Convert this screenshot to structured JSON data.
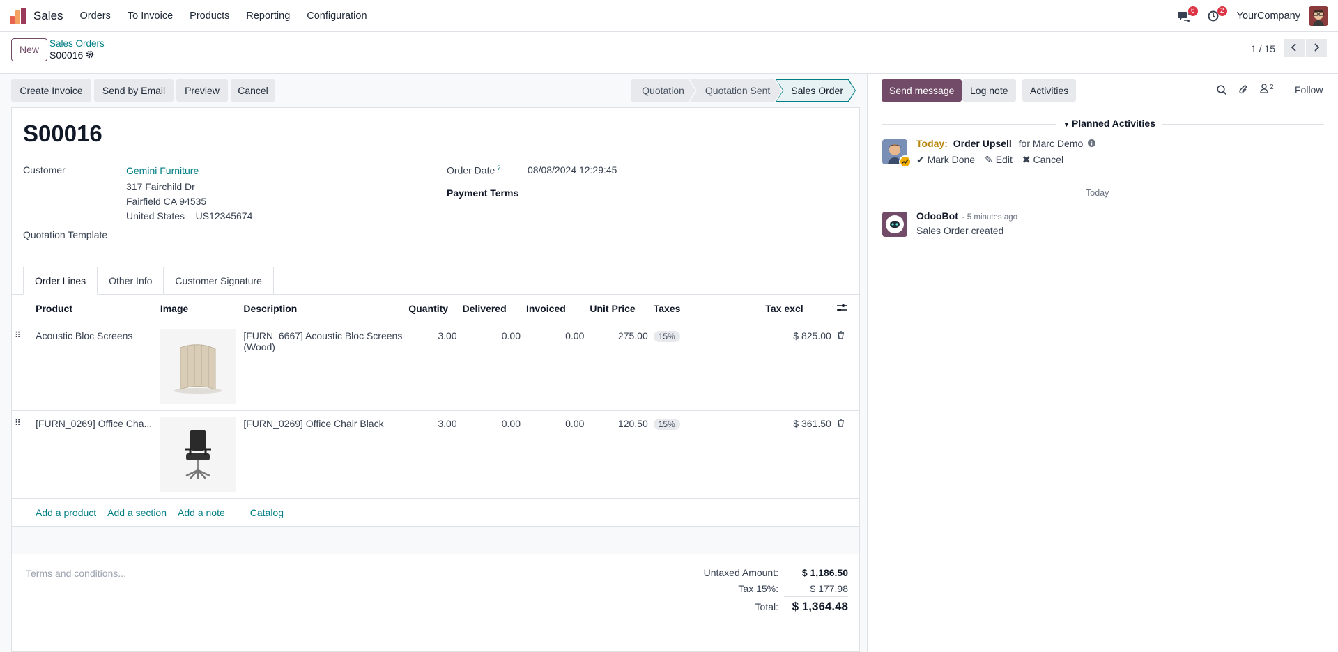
{
  "navbar": {
    "app_name": "Sales",
    "menu": [
      "Orders",
      "To Invoice",
      "Products",
      "Reporting",
      "Configuration"
    ],
    "messages_badge": "6",
    "activities_badge": "2",
    "company": "YourCompany"
  },
  "control_panel": {
    "new_label": "New",
    "breadcrumb_parent": "Sales Orders",
    "breadcrumb_current": "S00016",
    "pager": "1 / 15"
  },
  "statusbar": {
    "buttons": [
      "Create Invoice",
      "Send by Email",
      "Preview",
      "Cancel"
    ],
    "stages": [
      "Quotation",
      "Quotation Sent",
      "Sales Order"
    ],
    "active_stage": "Sales Order"
  },
  "form": {
    "title": "S00016",
    "customer_label": "Customer",
    "customer_name": "Gemini Furniture",
    "address_line1": "317 Fairchild Dr",
    "address_line2": "Fairfield CA 94535",
    "address_line3": "United States – US12345674",
    "template_label": "Quotation Template",
    "order_date_label": "Order Date",
    "order_date_help": "?",
    "order_date_value": "08/08/2024 12:29:45",
    "payment_terms_label": "Payment Terms"
  },
  "tabs": [
    "Order Lines",
    "Other Info",
    "Customer Signature"
  ],
  "order_lines": {
    "columns": {
      "product": "Product",
      "image": "Image",
      "description": "Description",
      "quantity": "Quantity",
      "delivered": "Delivered",
      "invoiced": "Invoiced",
      "unit_price": "Unit Price",
      "taxes": "Taxes",
      "subtotal": "Tax excl"
    },
    "rows": [
      {
        "product": "Acoustic Bloc Screens",
        "image_icon": "acoustic-screen-image",
        "description": "[FURN_6667] Acoustic Bloc Screens (Wood)",
        "quantity": "3.00",
        "delivered": "0.00",
        "invoiced": "0.00",
        "unit_price": "275.00",
        "tax": "15%",
        "subtotal": "$ 825.00"
      },
      {
        "product": "[FURN_0269] Office Cha...",
        "image_icon": "office-chair-image",
        "description": "[FURN_0269] Office Chair Black",
        "quantity": "3.00",
        "delivered": "0.00",
        "invoiced": "0.00",
        "unit_price": "120.50",
        "tax": "15%",
        "subtotal": "$ 361.50"
      }
    ],
    "add_links": [
      "Add a product",
      "Add a section",
      "Add a note",
      "Catalog"
    ]
  },
  "terms_placeholder": "Terms and conditions...",
  "totals": {
    "untaxed_label": "Untaxed Amount:",
    "untaxed_value": "$ 1,186.50",
    "tax_label": "Tax 15%:",
    "tax_value": "$ 177.98",
    "total_label": "Total:",
    "total_value": "$ 1,364.48"
  },
  "chatter": {
    "send_message": "Send message",
    "log_note": "Log note",
    "activities": "Activities",
    "followers_count": "2",
    "follow": "Follow",
    "planned_title": "Planned Activities",
    "activity": {
      "when": "Today:",
      "summary": "Order Upsell",
      "for": "for Marc Demo",
      "mark_done": "Mark Done",
      "edit": "Edit",
      "cancel": "Cancel"
    },
    "separator": "Today",
    "message": {
      "author": "OdooBot",
      "time": "- 5 minutes ago",
      "body": "Sales Order created"
    }
  },
  "colors": {
    "brand": "#714b67",
    "link": "#017e84",
    "badge": "#dc3545"
  }
}
